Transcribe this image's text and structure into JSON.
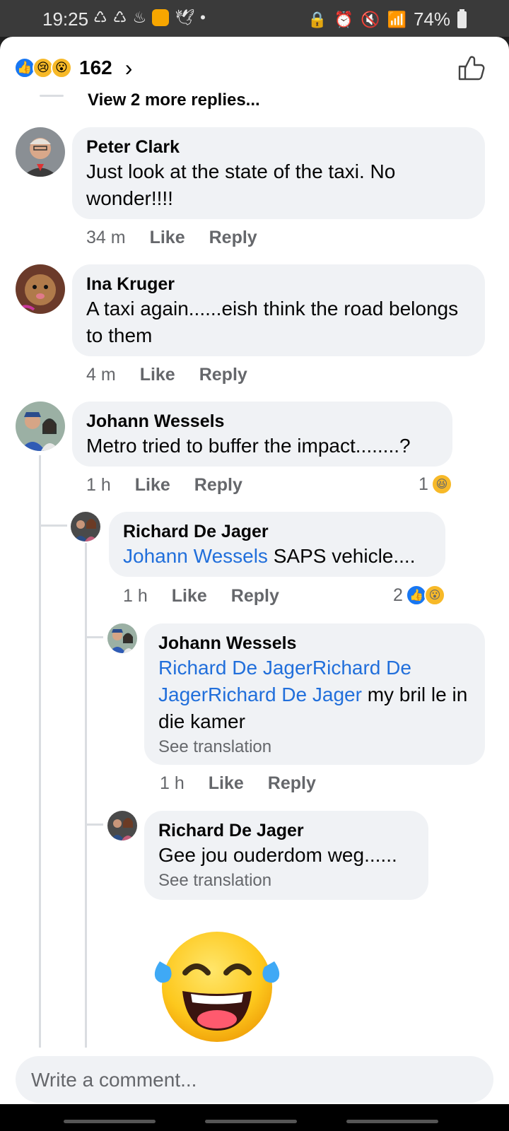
{
  "status_bar": {
    "time": "19:25",
    "battery": "74%"
  },
  "header": {
    "reaction_count": "162",
    "reactions": [
      "like",
      "sad",
      "wow"
    ]
  },
  "view_more": "View 2 more replies...",
  "comments": [
    {
      "author": "Peter Clark",
      "text": "Just look at the state of the taxi. No wonder!!!!",
      "time": "34 m",
      "like": "Like",
      "reply": "Reply"
    },
    {
      "author": "Ina Kruger",
      "text": "A taxi again......eish think the road belongs to them",
      "time": "4 m",
      "like": "Like",
      "reply": "Reply"
    },
    {
      "author": "Johann Wessels",
      "text": "Metro tried to buffer the impact........?",
      "time": "1 h",
      "like": "Like",
      "reply": "Reply",
      "reaction_count": "1",
      "reactions": [
        "haha"
      ]
    }
  ],
  "replies": [
    {
      "author": "Richard De Jager",
      "mention": "Johann Wessels",
      "text": " SAPS vehicle....",
      "time": "1 h",
      "like": "Like",
      "reply": "Reply",
      "reaction_count": "2",
      "reactions": [
        "like",
        "wow"
      ]
    },
    {
      "author": "Johann Wessels",
      "mention": "Richard De JagerRichard De JagerRichard De Jager",
      "text": " my bril le in die kamer",
      "see_translation": "See translation",
      "time": "1 h",
      "like": "Like",
      "reply": "Reply"
    },
    {
      "author": "Richard De Jager",
      "text": "Gee jou ouderdom weg......",
      "see_translation": "See translation"
    }
  ],
  "composer": {
    "placeholder": "Write a comment..."
  },
  "colors": {
    "accent": "#1877f2",
    "mention": "#216fdb",
    "bubble": "#f0f2f5",
    "meta": "#65676b"
  }
}
